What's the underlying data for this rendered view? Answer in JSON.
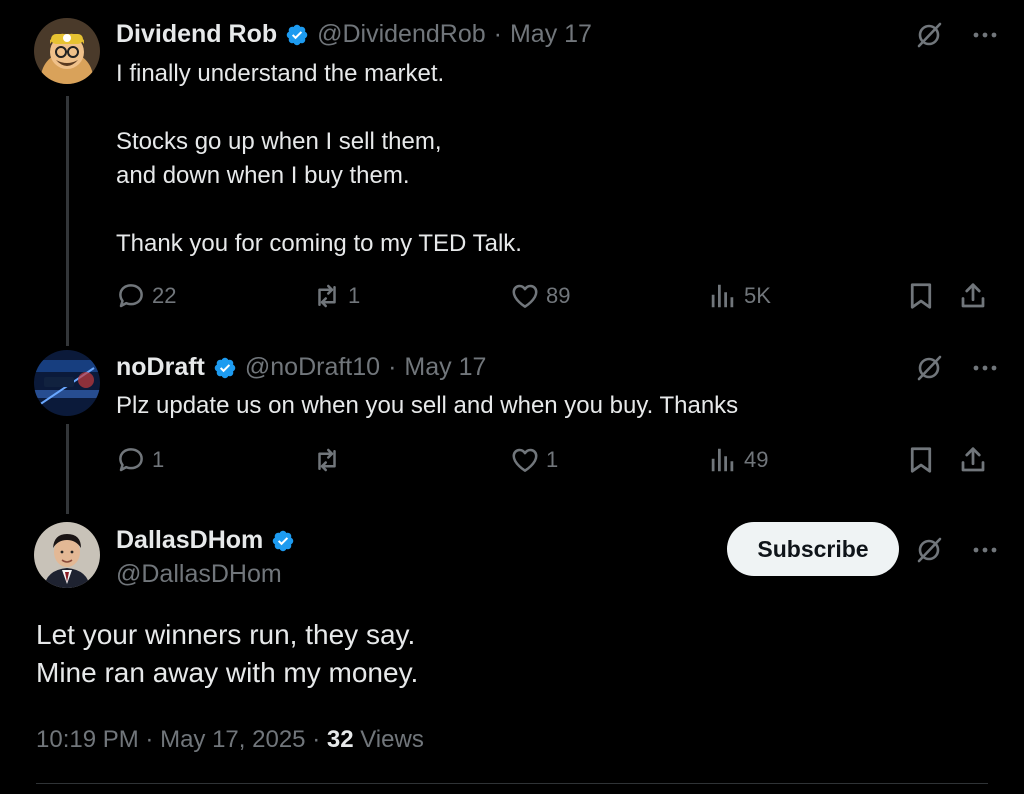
{
  "tweet1": {
    "name": "Dividend Rob",
    "handle": "@DividendRob",
    "sep": "·",
    "date": "May 17",
    "lines": [
      "I finally understand the market.",
      "",
      "Stocks go up when I sell them,",
      "and down when I buy them.",
      "",
      "Thank you for coming to my TED Talk."
    ],
    "replies": "22",
    "reposts": "1",
    "likes": "89",
    "views": "5K"
  },
  "tweet2": {
    "name": "noDraft",
    "handle": "@noDraft10",
    "sep": "·",
    "date": "May 17",
    "text": "Plz update us on when you sell and when you buy. Thanks",
    "replies": "1",
    "reposts": "",
    "likes": "1",
    "views": "49"
  },
  "main": {
    "name": "DallasDHom",
    "handle": "@DallasDHom",
    "subscribe_label": "Subscribe",
    "lines": [
      "Let your winners run, they say.",
      "Mine ran away with my money."
    ],
    "time": "10:19 PM",
    "sep": "·",
    "date": "May 17, 2025",
    "views_count": "32",
    "views_label": "Views"
  },
  "colors": {
    "bg": "#000000",
    "text": "#e7e9ea",
    "muted": "#71767b",
    "verified": "#1d9bf0"
  },
  "icons": [
    "verified-badge-icon",
    "grok-icon",
    "more-icon",
    "reply-icon",
    "repost-icon",
    "like-icon",
    "views-icon",
    "bookmark-icon",
    "share-icon"
  ]
}
